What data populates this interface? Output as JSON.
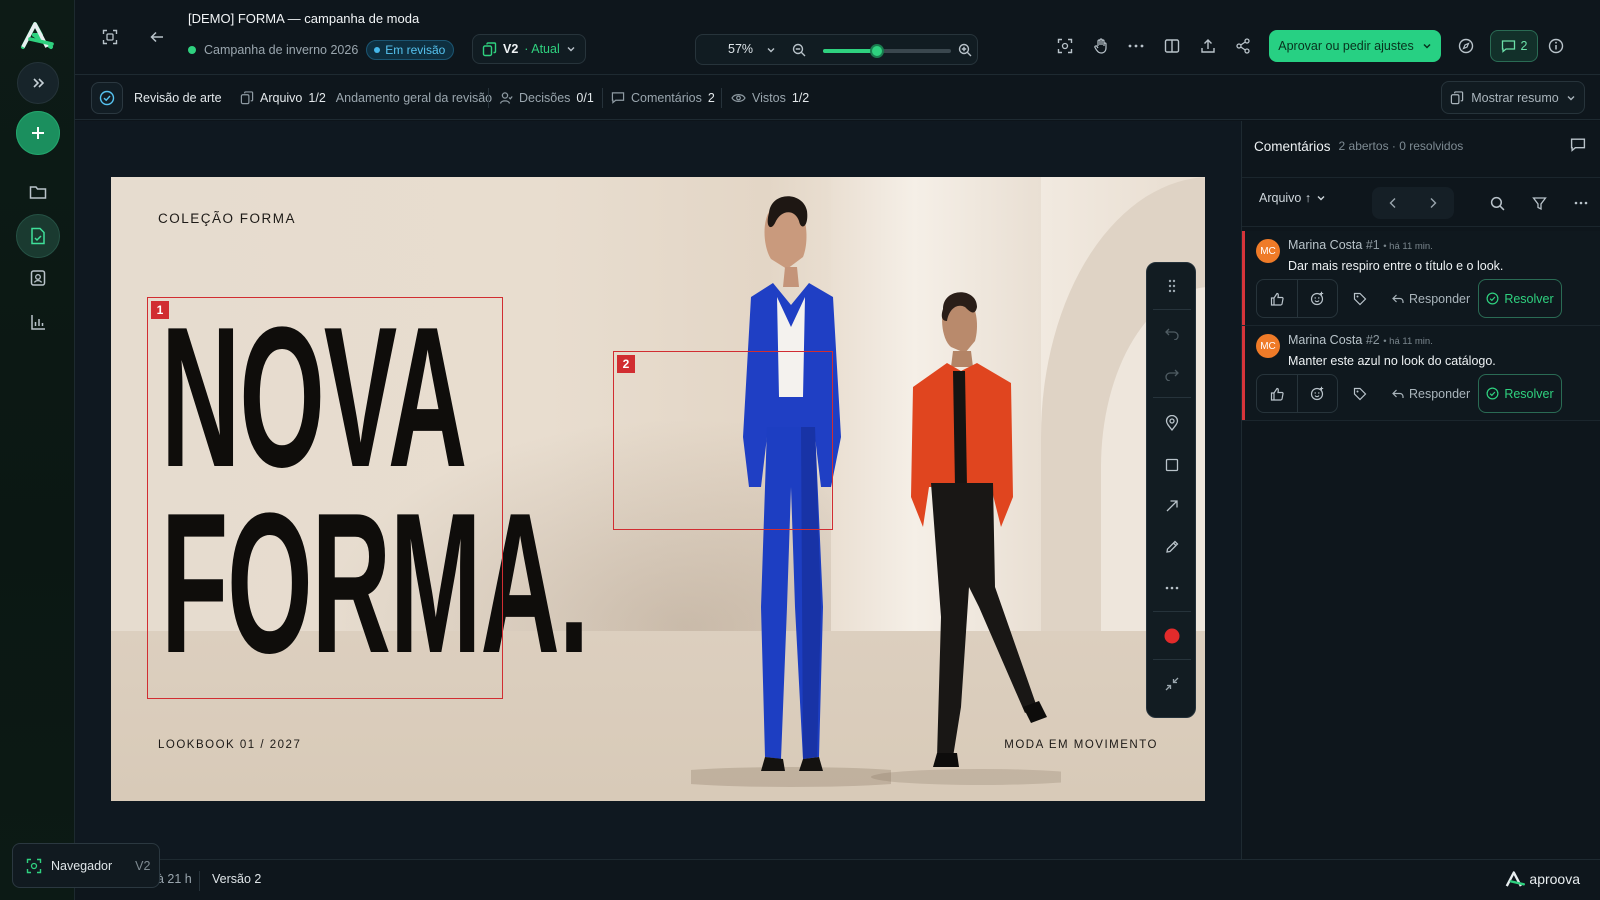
{
  "app": {
    "brand": "aproova"
  },
  "header": {
    "title": "[DEMO] FORMA — campanha de moda",
    "campaign": "Campanha de inverno 2026",
    "status_badge": "Em revisão",
    "version": "V2",
    "version_current": "· Atual",
    "zoom": "57%",
    "zoom_fraction": 0.42,
    "approve_label": "Aprovar ou pedir ajustes",
    "comments_count": "2"
  },
  "subbar": {
    "art_review": "Revisão de arte",
    "file_label": "Arquivo",
    "file_value": "1/2",
    "overall_label": "Andamento geral da revisão",
    "decisions_label": "Decisões",
    "decisions_value": "0/1",
    "comments_label": "Comentários",
    "comments_value": "2",
    "views_label": "Vistos",
    "views_value": "1/2",
    "summary_label": "Mostrar resumo"
  },
  "artwork": {
    "eyebrow": "COLEÇÃO FORMA",
    "headline_line1": "NOVA",
    "headline_line2": "FORMA.",
    "footer_left": "LOOKBOOK 01 / 2027",
    "footer_right": "MODA EM MOVIMENTO",
    "annotations": [
      "1",
      "2"
    ]
  },
  "panel": {
    "title": "Comentários",
    "summary": "2 abertos · 0 resolvidos",
    "sort_label": "Arquivo ↑",
    "comments": [
      {
        "initials": "MC",
        "author": "Marina Costa",
        "number": "#1",
        "time": "• há 11 min.",
        "text": "Dar mais respiro entre o título e o look.",
        "reply": "Responder",
        "resolve": "Resolver"
      },
      {
        "initials": "MC",
        "author": "Marina Costa",
        "number": "#2",
        "time": "• há 11 min.",
        "text": "Manter este azul no look do catálogo.",
        "reply": "Responder",
        "resolve": "Resolver"
      }
    ]
  },
  "bottom": {
    "navigator": "Navegador",
    "navigator_version": "V2",
    "time": "à 21 h",
    "version_label": "Versão 2"
  },
  "colors": {
    "accent": "#27d083",
    "annotation": "#d12d31",
    "review_badge": "#45b7ea",
    "avatar": "#ef7b28"
  }
}
